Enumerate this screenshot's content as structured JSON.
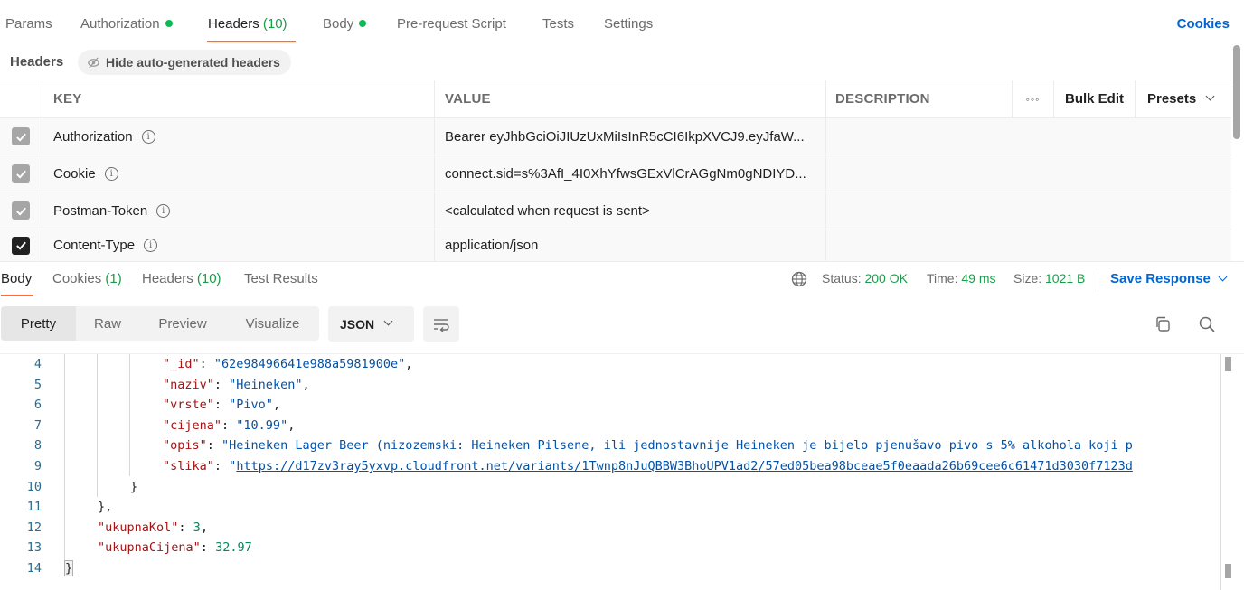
{
  "request_tabs": [
    {
      "label": "Params",
      "count": null,
      "dot": false
    },
    {
      "label": "Authorization",
      "count": null,
      "dot": true
    },
    {
      "label": "Headers",
      "count": "(10)",
      "dot": false,
      "active": true
    },
    {
      "label": "Body",
      "count": null,
      "dot": true
    },
    {
      "label": "Pre-request Script",
      "count": null,
      "dot": false
    },
    {
      "label": "Tests",
      "count": null,
      "dot": false
    },
    {
      "label": "Settings",
      "count": null,
      "dot": false
    }
  ],
  "cookies_link": "Cookies",
  "headers_bar": {
    "label": "Headers",
    "hide_auto_button": "Hide auto-generated headers"
  },
  "headers_table": {
    "columns": {
      "key": "KEY",
      "value": "VALUE",
      "description": "DESCRIPTION"
    },
    "more_label": "ooo",
    "bulk_edit": "Bulk Edit",
    "presets": "Presets",
    "rows": [
      {
        "key": "Authorization",
        "value": "Bearer eyJhbGciOiJIUzUxMiIsInR5cCI6IkpXVCJ9.eyJfaW...",
        "description": "",
        "checked": true,
        "disabled": true
      },
      {
        "key": "Cookie",
        "value": "connect.sid=s%3AfI_4I0XhYfwsGExVlCrAGgNm0gNDIYD...",
        "description": "",
        "checked": true,
        "disabled": true
      },
      {
        "key": "Postman-Token",
        "value": "<calculated when request is sent>",
        "description": "",
        "checked": true,
        "disabled": true
      },
      {
        "key": "Content-Type",
        "value": "application/json",
        "description": "",
        "checked": true,
        "disabled": false
      }
    ]
  },
  "response_tabs": [
    {
      "label": "Body",
      "count": "",
      "active": true
    },
    {
      "label": "Cookies",
      "count": "(1)"
    },
    {
      "label": "Headers",
      "count": "(10)"
    },
    {
      "label": "Test Results",
      "count": ""
    }
  ],
  "status": {
    "status_label": "Status:",
    "status_value": "200 OK",
    "time_label": "Time:",
    "time_value": "49 ms",
    "size_label": "Size:",
    "size_value": "1021 B",
    "save_response": "Save Response"
  },
  "format_toolbar": {
    "modes": [
      "Pretty",
      "Raw",
      "Preview",
      "Visualize"
    ],
    "active_mode": "Pretty",
    "language": "JSON"
  },
  "code_lines": [
    {
      "n": "4",
      "indent": 3,
      "key": "_id",
      "value": "\"62e98496641e988a5981900e\"",
      "vtype": "s",
      "comma": true
    },
    {
      "n": "5",
      "indent": 3,
      "key": "naziv",
      "value": "\"Heineken\"",
      "vtype": "s",
      "comma": true
    },
    {
      "n": "6",
      "indent": 3,
      "key": "vrste",
      "value": "\"Pivo\"",
      "vtype": "s",
      "comma": true
    },
    {
      "n": "7",
      "indent": 3,
      "key": "cijena",
      "value": "\"10.99\"",
      "vtype": "s",
      "comma": true
    },
    {
      "n": "8",
      "indent": 3,
      "key": "opis",
      "value": "\"Heineken Lager Beer (nizozemski: Heineken Pilsene, ili jednostavnije Heineken je bijelo pjenušavo pivo s 5% alkohola koji p",
      "vtype": "s",
      "comma": false
    },
    {
      "n": "9",
      "indent": 3,
      "key": "slika",
      "value": "https://d17zv3ray5yxvp.cloudfront.net/variants/1Twnp8nJuQBBW3BhoUPV1ad2/57ed05bea98bceae5f0eaada26b69cee6c61471d3030f7123d",
      "vtype": "link",
      "comma": false
    },
    {
      "n": "10",
      "indent": 2,
      "raw": "}"
    },
    {
      "n": "11",
      "indent": 1,
      "raw": "},"
    },
    {
      "n": "12",
      "indent": 1,
      "key": "ukupnaKol",
      "value": "3",
      "vtype": "n",
      "comma": true
    },
    {
      "n": "13",
      "indent": 1,
      "key": "ukupnaCijena",
      "value": "32.97",
      "vtype": "n",
      "comma": false
    },
    {
      "n": "14",
      "indent": 0,
      "raw": "}",
      "boxed": true
    }
  ]
}
